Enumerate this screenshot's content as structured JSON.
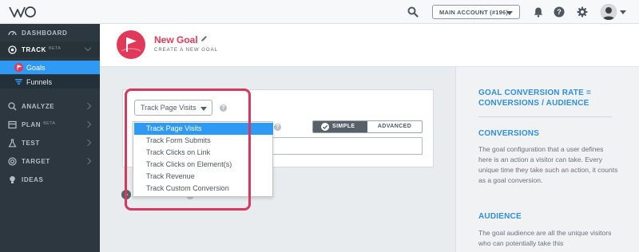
{
  "topbar": {
    "account_label": "MAIN ACCOUNT (#196)",
    "icons": [
      "search-icon",
      "bell-icon",
      "help-icon",
      "gear-icon",
      "avatar"
    ]
  },
  "sidebar": {
    "items": [
      {
        "label": "DASHBOARD",
        "icon": "dashboard-icon"
      },
      {
        "label": "TRACK",
        "beta": "BETA",
        "icon": "target-icon"
      },
      {
        "label": "ANALYZE",
        "icon": "analyze-icon"
      },
      {
        "label": "PLAN",
        "beta": "BETA",
        "icon": "plan-icon"
      },
      {
        "label": "TEST",
        "icon": "flask-icon"
      },
      {
        "label": "TARGET",
        "icon": "target-icon"
      },
      {
        "label": "IDEAS",
        "icon": "bulb-icon"
      }
    ],
    "track_sub": [
      {
        "label": "Goals",
        "icon": "goal-flag-icon",
        "active": true
      },
      {
        "label": "Funnels",
        "icon": "funnel-icon",
        "active": false
      }
    ]
  },
  "header": {
    "title": "New Goal",
    "subtitle": "CREATE A NEW GOAL"
  },
  "form": {
    "goal_type_selected": "Track Page Visits",
    "mode_simple": "SIMPLE",
    "mode_advanced": "ADVANCED",
    "help_glyph": "?",
    "url_value": ""
  },
  "dropdown": {
    "options": [
      "Track Page Visits",
      "Track Form Submits",
      "Track Clicks on Link",
      "Track Clicks on Element(s)",
      "Track Revenue",
      "Track Custom Conversion"
    ],
    "selected_index": 0
  },
  "info_panel": {
    "heading": "GOAL CONVERSION RATE = CONVERSIONS / AUDIENCE",
    "conversions_title": "CONVERSIONS",
    "conversions_text": "The goal configuration that a user defines here is an action a visitor can take. Every unique time they take such an action, it counts as a goal conversion.",
    "audience_title": "AUDIENCE",
    "audience_text": "The goal audience are all the unique visitors who can potentially take this"
  },
  "colors": {
    "accent": "#2e9af4",
    "brand": "#e0395a",
    "sidebar_bg": "#2c3740"
  }
}
